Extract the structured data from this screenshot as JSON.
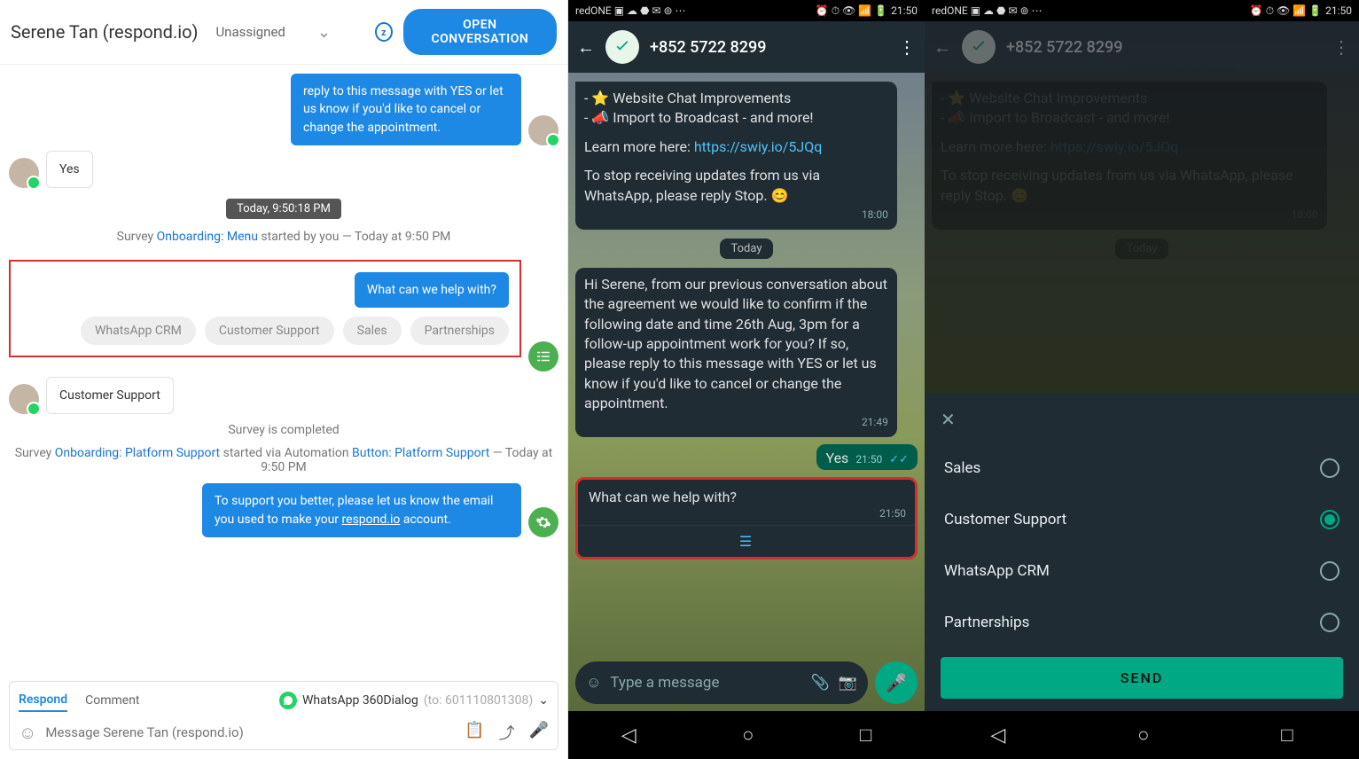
{
  "panel1": {
    "title": "Serene Tan (respond.io)",
    "assignee": "Unassigned",
    "open_btn": "OPEN CONVERSATION",
    "blue_msg_top": "reply to this message with YES or let us know if you'd like to cancel or change the appointment.",
    "yes_reply": "Yes",
    "date_pill": "Today, 9:50:18 PM",
    "survey_started_prefix": "Survey ",
    "survey_started_link": "Onboarding: Menu",
    "survey_started_suffix": " started by you — Today at 9:50 PM",
    "help_question": "What can we help with?",
    "chips": [
      "WhatsApp CRM",
      "Customer Support",
      "Sales",
      "Partnerships"
    ],
    "cust_support_reply": "Customer Support",
    "survey_completed": "Survey is completed",
    "survey2_prefix": "Survey ",
    "survey2_link1": "Onboarding: Platform Support",
    "survey2_mid": " started via Automation ",
    "survey2_link2": "Button: Platform Support",
    "survey2_suffix": " — Today at 9:50 PM",
    "support_msg_a": "To support you better, please let us know the email you used to make your ",
    "support_msg_link": "respond.io",
    "support_msg_b": " account.",
    "footer": {
      "tab_respond": "Respond",
      "tab_comment": "Comment",
      "channel_name": "WhatsApp 360Dialog",
      "channel_to": "(to: 601110801308)",
      "placeholder": "Message Serene Tan (respond.io)"
    }
  },
  "phone": {
    "carrier": "redONE",
    "time": "21:50",
    "number": "+852 5722 8299",
    "bullet1_pre": "- ⭐  ",
    "bullet1": "Website Chat Improvements",
    "bullet2_pre": "- 📣  ",
    "bullet2": "Import to Broadcast - and more!",
    "learn_more": "Learn more here: ",
    "learn_link": "https://swiy.io/5JQq",
    "stop_msg": "To stop receiving updates from us via WhatsApp, please reply Stop. 😊",
    "time_1800": "18:00",
    "today_label": "Today",
    "long_msg": "Hi Serene, from our previous conversation about the agreement we would like to confirm if the following date and time 26th Aug, 3pm for a follow-up appointment work for you? If so, please reply to this message with YES or let us know if you'd like to cancel or change the appointment.",
    "time_2149": "21:49",
    "out_yes": "Yes",
    "time_2150": "21:50",
    "help_q": "What can we help with?",
    "input_placeholder": "Type a message"
  },
  "sheet": {
    "options": [
      "Sales",
      "Customer Support",
      "WhatsApp CRM",
      "Partnerships"
    ],
    "selected": "Customer Support",
    "send": "SEND"
  }
}
